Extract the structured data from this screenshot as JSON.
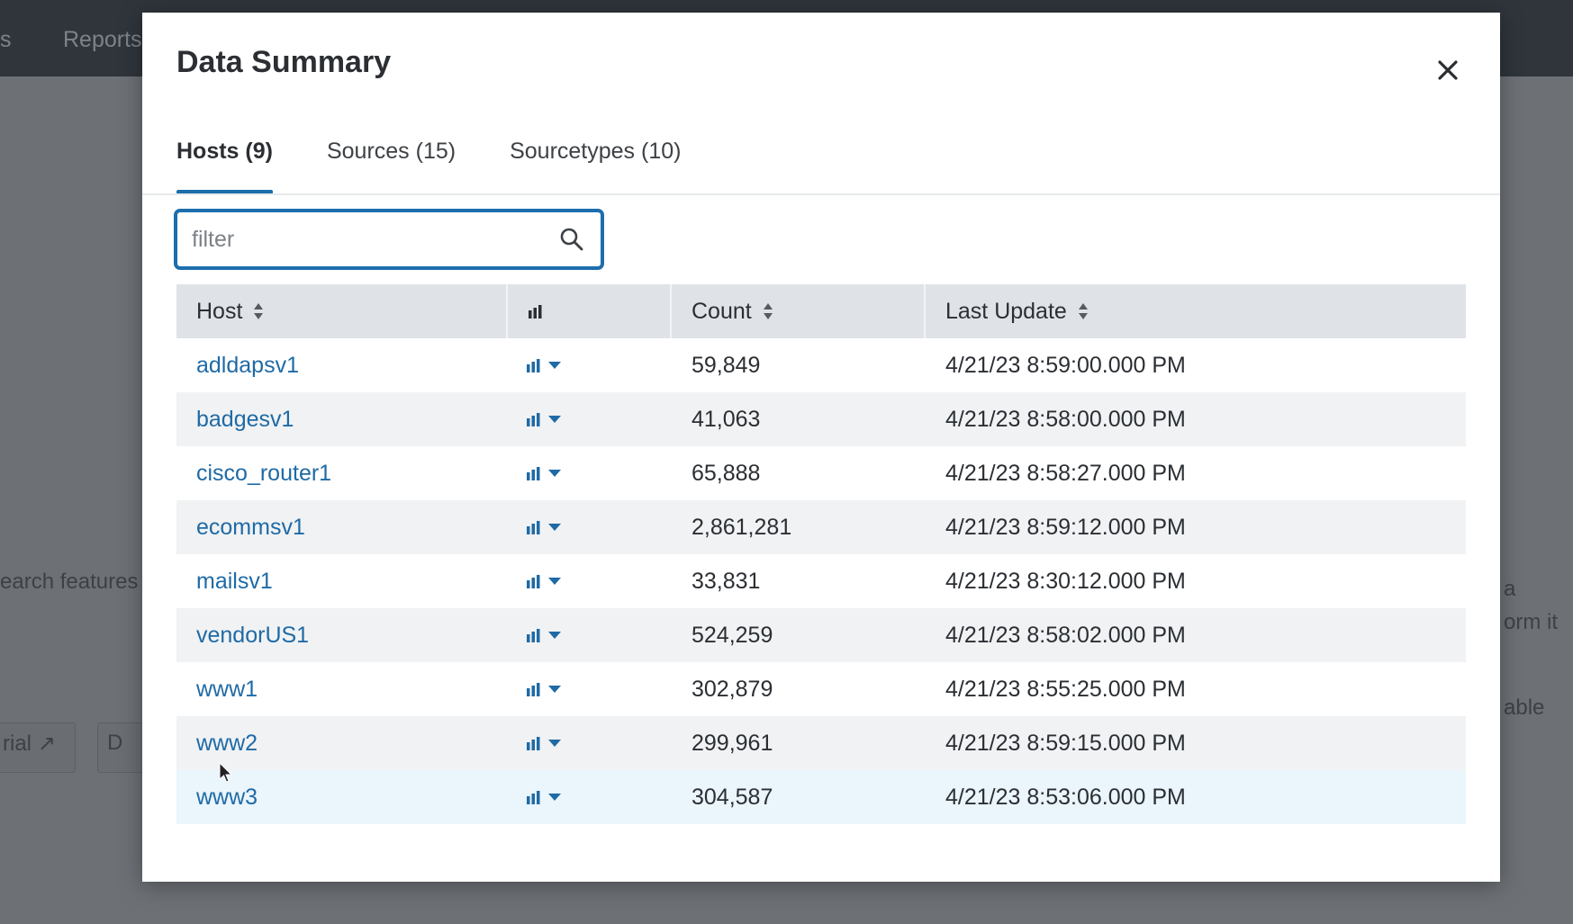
{
  "background": {
    "nav_items": [
      "s",
      "Reports"
    ],
    "text_left": "earch features",
    "text_right": [
      "a",
      "orm it",
      "able"
    ],
    "buttons": [
      "rial",
      "D"
    ]
  },
  "modal": {
    "title": "Data Summary",
    "close_icon": "close-icon",
    "tabs": [
      {
        "label": "Hosts (9)",
        "active": true
      },
      {
        "label": "Sources (15)",
        "active": false
      },
      {
        "label": "Sourcetypes (10)",
        "active": false
      }
    ],
    "filter": {
      "placeholder": "filter",
      "value": ""
    },
    "table": {
      "columns": {
        "host": "Host",
        "chart": "bar-chart-icon",
        "count": "Count",
        "last_update": "Last Update"
      },
      "rows": [
        {
          "host": "adldapsv1",
          "count": "59,849",
          "last_update": "4/21/23 8:59:00.000 PM"
        },
        {
          "host": "badgesv1",
          "count": "41,063",
          "last_update": "4/21/23 8:58:00.000 PM"
        },
        {
          "host": "cisco_router1",
          "count": "65,888",
          "last_update": "4/21/23 8:58:27.000 PM"
        },
        {
          "host": "ecommsv1",
          "count": "2,861,281",
          "last_update": "4/21/23 8:59:12.000 PM"
        },
        {
          "host": "mailsv1",
          "count": "33,831",
          "last_update": "4/21/23 8:30:12.000 PM"
        },
        {
          "host": "vendorUS1",
          "count": "524,259",
          "last_update": "4/21/23 8:58:02.000 PM"
        },
        {
          "host": "www1",
          "count": "302,879",
          "last_update": "4/21/23 8:55:25.000 PM"
        },
        {
          "host": "www2",
          "count": "299,961",
          "last_update": "4/21/23 8:59:15.000 PM"
        },
        {
          "host": "www3",
          "count": "304,587",
          "last_update": "4/21/23 8:53:06.000 PM"
        }
      ]
    }
  },
  "colors": {
    "accent": "#1d6ead",
    "link": "#1f6aa5",
    "header_bg": "#dfe2e6",
    "stripe": "#f0f2f4",
    "hover": "#eaf5fc"
  }
}
